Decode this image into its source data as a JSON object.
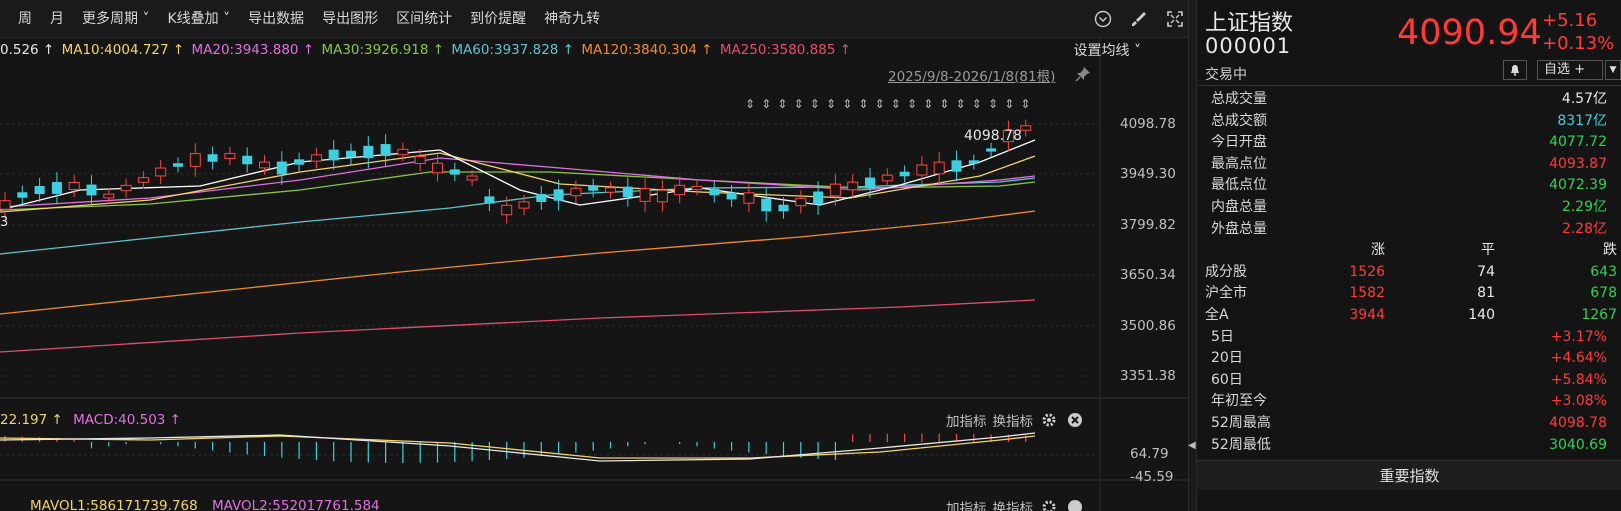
{
  "toolbar": {
    "items": [
      "周",
      "月",
      "更多周期 ˅",
      "K线叠加 ˅",
      "导出数据",
      "导出图形",
      "区间统计",
      "到价提醒",
      "神奇九转"
    ]
  },
  "ma": [
    {
      "text": "0.526 ↑",
      "color": "#e8e8e8"
    },
    {
      "text": "MA10:4004.727 ↑",
      "color": "#f3d46a"
    },
    {
      "text": "MA20:3943.880 ↑",
      "color": "#e070e0"
    },
    {
      "text": "MA30:3926.918 ↑",
      "color": "#8ac34a"
    },
    {
      "text": "MA60:3937.828 ↑",
      "color": "#5fc3cf"
    },
    {
      "text": "MA120:3840.304 ↑",
      "color": "#f08a2a"
    },
    {
      "text": "MA250:3580.885 ↑",
      "color": "#e0506a"
    }
  ],
  "settings_label": "设置均线 ˅",
  "range_label": "2025/9/8-2026/1/8(81根)",
  "y_labels": [
    "4098.78",
    "3949.30",
    "3799.82",
    "3650.34",
    "3500.86",
    "3351.38"
  ],
  "left_edge_label": "3",
  "peak_label": "4098.78",
  "macd": {
    "prefix": "22.197 ↑",
    "label": "MACD:40.503 ↑",
    "top": "64.79",
    "bottom": "-45.59"
  },
  "subtools": {
    "add": "加指标",
    "switch": "换指标"
  },
  "vol": {
    "label1": "MAVOL1:586171739.768",
    "label2": "MAVOL2:552017761.584"
  },
  "quote": {
    "name": "上证指数",
    "code": "000001",
    "price": "4090.94",
    "chg": "+5.16",
    "pct": "+0.13%",
    "status": "交易中",
    "watch": "自选 +",
    "dd": "▼",
    "rows": [
      {
        "k": "总成交量",
        "v": "4.57亿",
        "c": "white"
      },
      {
        "k": "总成交额",
        "v": "8317亿",
        "c": "cyan"
      },
      {
        "k": "今日开盘",
        "v": "4077.72",
        "c": "green"
      },
      {
        "k": "最高点位",
        "v": "4093.87",
        "c": "red"
      },
      {
        "k": "最低点位",
        "v": "4072.39",
        "c": "green"
      },
      {
        "k": "内盘总量",
        "v": "2.29亿",
        "c": "green"
      },
      {
        "k": "外盘总量",
        "v": "2.28亿",
        "c": "red"
      }
    ],
    "breadth_head": [
      "涨",
      "平",
      "跌"
    ],
    "breadth": [
      {
        "k": "成分股",
        "up": "1526",
        "flat": "74",
        "down": "643"
      },
      {
        "k": "沪全市",
        "up": "1582",
        "flat": "81",
        "down": "678"
      },
      {
        "k": "全A",
        "up": "3944",
        "flat": "140",
        "down": "1267"
      }
    ],
    "perf": [
      {
        "k": "5日",
        "v": "+3.17%",
        "c": "red"
      },
      {
        "k": "20日",
        "v": "+4.64%",
        "c": "red"
      },
      {
        "k": "60日",
        "v": "+5.84%",
        "c": "red"
      },
      {
        "k": "年初至今",
        "v": "+3.08%",
        "c": "red"
      },
      {
        "k": "52周最高",
        "v": "4098.78",
        "c": "red"
      },
      {
        "k": "52周最低",
        "v": "3040.69",
        "c": "green"
      }
    ],
    "bottom_btn": "重要指数"
  }
}
